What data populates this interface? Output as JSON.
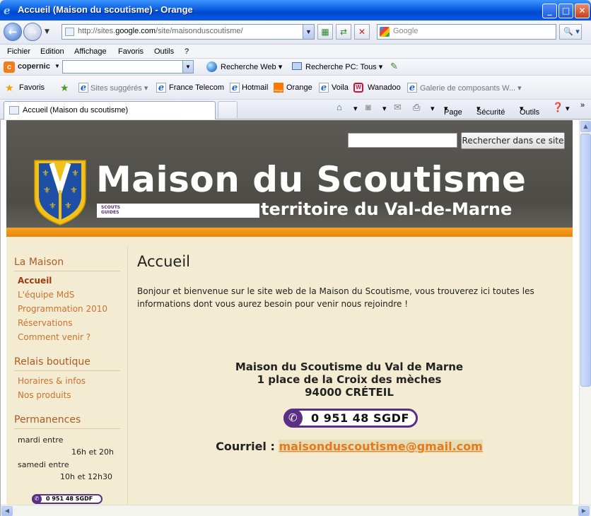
{
  "window": {
    "title": "Accueil (Maison du scoutisme) - Orange"
  },
  "address_bar": {
    "url_prefix": "http://sites.",
    "url_domain": "google.com",
    "url_path": "/site/maisonduscoutisme/",
    "search_placeholder": "Google"
  },
  "menu": [
    "Fichier",
    "Edition",
    "Affichage",
    "Favoris",
    "Outils",
    "?"
  ],
  "copernic": {
    "label": "copernic",
    "web_search": "Recherche Web",
    "pc_search": "Recherche PC: Tous"
  },
  "favorites": {
    "favoris": "Favoris",
    "items": [
      "Sites suggérés",
      "France Telecom",
      "Hotmail",
      "Orange",
      "Voila",
      "Wanadoo",
      "Galerie de composants W..."
    ],
    "orange_icon_text": "orange"
  },
  "tabs": {
    "active_label": "Accueil (Maison du scoutisme)",
    "tools": {
      "page": "Page",
      "security": "Sécurité",
      "tools": "Outils"
    }
  },
  "site": {
    "search_button": "Rechercher dans ce site",
    "title": "Maison du Scoutisme",
    "subtitle": "territoire du Val-de-Marne",
    "logo_text": "SCOUTS GUIDES",
    "sidebar": {
      "section1": "La Maison",
      "section1_links": [
        "Accueil",
        "L'équipe MdS",
        "Programmation 2010",
        "Réservations",
        "Comment venir ?"
      ],
      "section2": "Relais boutique",
      "section2_links": [
        "Horaires & infos",
        "Nos produits"
      ],
      "section3": "Permanences",
      "perm_day1": "mardi entre",
      "perm_time1": "16h et 20h",
      "perm_day2": "samedi entre",
      "perm_time2": "10h et 12h30",
      "phone": "0 951 48 SGDF"
    },
    "content": {
      "page_title": "Accueil",
      "intro": "Bonjour et bienvenue sur le site web de la Maison du Scoutisme, vous trouverez ici toutes les informations dont vous aurez besoin pour venir nous rejoindre !",
      "address_line1": "Maison du Scoutisme du Val de Marne",
      "address_line2": "1 place de la Croix des mèches",
      "address_line3": "94000 CRÉTEIL",
      "phone": "0 951 48 SGDF",
      "mail_label": "Courriel : ",
      "mail": "maisonduscoutisme@gmail.com"
    }
  }
}
